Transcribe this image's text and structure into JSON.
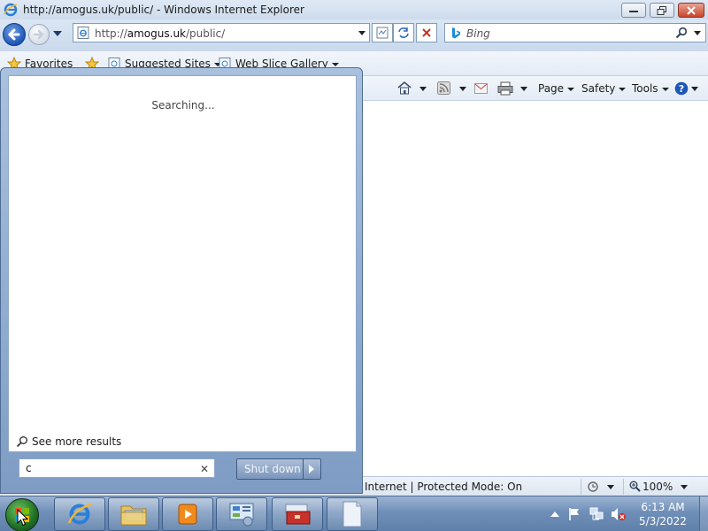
{
  "window": {
    "title": "http://amogus.uk/public/ - Windows Internet Explorer"
  },
  "address_bar": {
    "url_prefix": "http://",
    "url_domain": "amogus.uk",
    "url_suffix": "/public/"
  },
  "search_box": {
    "placeholder": "Bing"
  },
  "favorites_bar": {
    "favorites_label": "Favorites",
    "suggested_sites": "Suggested Sites",
    "web_slice_gallery": "Web Slice Gallery"
  },
  "command_bar": {
    "page": "Page",
    "safety": "Safety",
    "tools": "Tools"
  },
  "status_bar": {
    "zone_text": "Internet | Protected Mode: On",
    "zoom": "100%"
  },
  "start_menu": {
    "status": "Searching...",
    "see_more_results": "See more results",
    "search_value": "c",
    "clear_glyph": "✕",
    "shutdown_label": "Shut down"
  },
  "taskbar": {
    "time": "6:13 AM",
    "date": "5/3/2022",
    "pinned": [
      "internet-explorer",
      "windows-explorer",
      "media-player",
      "control-panel",
      "toolbox-app",
      "notepad"
    ]
  },
  "colors": {
    "accent": "#1d56b8",
    "close_button": "#c9452b",
    "taskbar": "#6f8fb8"
  }
}
